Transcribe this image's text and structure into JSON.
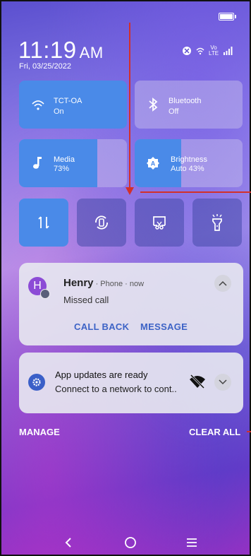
{
  "status": {
    "time": "11:19",
    "ampm": "AM",
    "date": "Fri, 03/25/2022",
    "network_label": "Vo LTE"
  },
  "tiles": [
    {
      "id": "wifi",
      "title": "TCT-OA",
      "sub": "On",
      "state": "active",
      "icon": "wifi-icon"
    },
    {
      "id": "bluetooth",
      "title": "Bluetooth",
      "sub": "Off",
      "state": "inactive",
      "icon": "bluetooth-icon"
    },
    {
      "id": "media",
      "title": "Media",
      "sub": "73%",
      "state": "slider",
      "level": 0.73,
      "icon": "music-note-icon"
    },
    {
      "id": "brightness",
      "title": "Brightness",
      "sub": "Auto 43%",
      "state": "slider",
      "level": 0.43,
      "icon": "brightness-icon"
    }
  ],
  "quick_toggles": [
    {
      "id": "data",
      "icon": "mobile-data-icon",
      "state": "active"
    },
    {
      "id": "rotate",
      "icon": "auto-rotate-icon",
      "state": "inactive"
    },
    {
      "id": "screenshot",
      "icon": "screenshot-icon",
      "state": "inactive"
    },
    {
      "id": "flashlight",
      "icon": "flashlight-icon",
      "state": "inactive"
    }
  ],
  "notification1": {
    "avatar_letter": "H",
    "name": "Henry",
    "meta": " · Phone · now",
    "body": "Missed call",
    "actions": [
      "CALL BACK",
      "MESSAGE"
    ]
  },
  "notification2": {
    "title": "App updates are ready",
    "body": "Connect to a network to cont.."
  },
  "footer": {
    "manage": "MANAGE",
    "clear_all": "CLEAR ALL"
  },
  "colors": {
    "active_tile": "#4a8ae8",
    "accent_action": "#3d63c6",
    "annotation_red": "#d2302a",
    "avatar": "#8c4bd6"
  }
}
